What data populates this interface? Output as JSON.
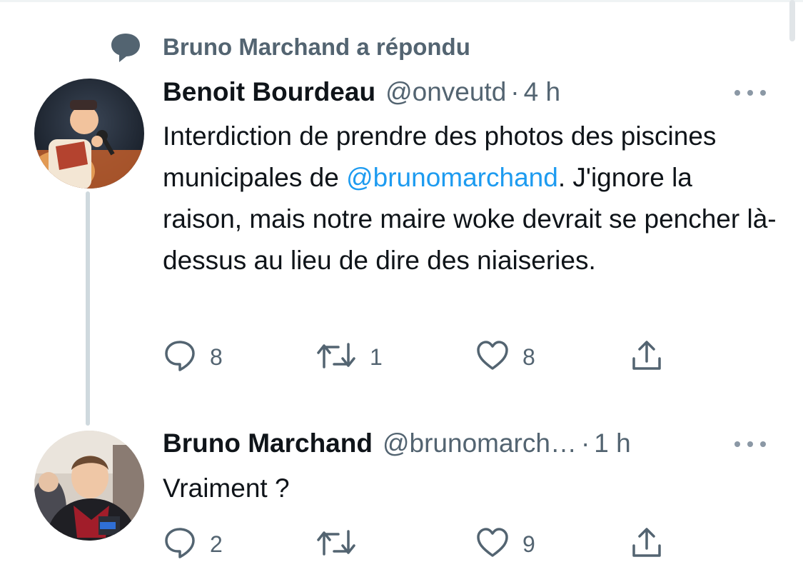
{
  "context": {
    "label": "Bruno Marchand a répondu",
    "icon": "speech-bubble-icon"
  },
  "tweets": [
    {
      "name": "Benoit Bourdeau",
      "handle": "@onveutd",
      "dot": "·",
      "time": "4 h",
      "text_before": "Interdiction de prendre des photos des piscines municipales de ",
      "mention": "@brunomarchand",
      "text_after": ". J'ignore la raison, mais notre maire woke devrait se pencher là-dessus au lieu de dire des niaiseries.",
      "replies": "8",
      "retweets": "1",
      "likes": "8"
    },
    {
      "name": "Bruno Marchand",
      "handle": "@brunomarch…",
      "dot": "·",
      "time": "1 h",
      "text": "Vraiment ?",
      "replies": "2",
      "retweets": "",
      "likes": "9"
    }
  ],
  "icons": {
    "reply": "reply-icon",
    "retweet": "retweet-icon",
    "like": "heart-icon",
    "share": "share-icon",
    "more": "more-options-icon"
  },
  "colors": {
    "text": "#0f1419",
    "secondary": "#536471",
    "mention": "#1d9bf0",
    "thread": "#cfd9de"
  }
}
